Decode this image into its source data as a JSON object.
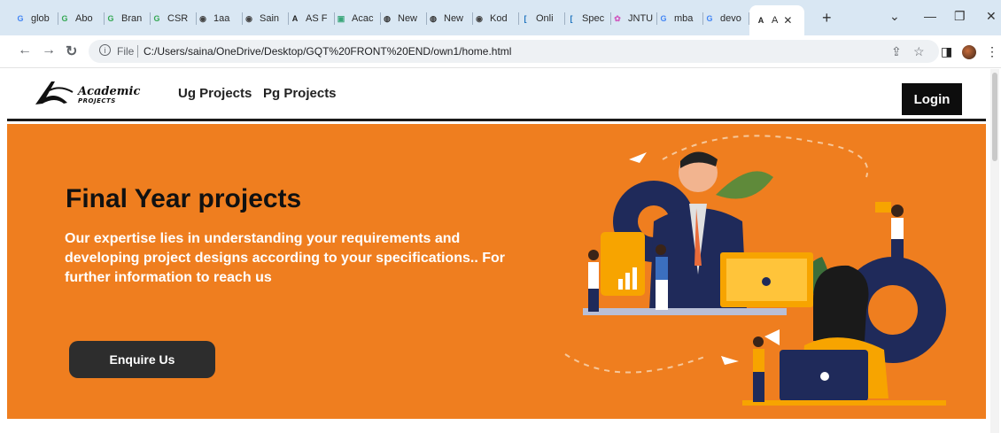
{
  "browser": {
    "tabs": [
      {
        "label": "glob",
        "icon": "google-icon",
        "color": "#4285f4"
      },
      {
        "label": "Abo",
        "icon": "google-icon",
        "color": "#34a853"
      },
      {
        "label": "Bran",
        "icon": "google-icon",
        "color": "#34a853"
      },
      {
        "label": "CSR",
        "icon": "google-icon",
        "color": "#34a853"
      },
      {
        "label": "1aa",
        "icon": "globe-icon",
        "color": "#444444"
      },
      {
        "label": "Sain",
        "icon": "globe-icon",
        "color": "#444444"
      },
      {
        "label": "AS F",
        "icon": "academic-icon",
        "color": "#222222"
      },
      {
        "label": "Acac",
        "icon": "site-icon",
        "color": "#3aa67a"
      },
      {
        "label": "New",
        "icon": "github-icon",
        "color": "#333333"
      },
      {
        "label": "New",
        "icon": "github-icon",
        "color": "#333333"
      },
      {
        "label": "Kod",
        "icon": "globe-icon",
        "color": "#444444"
      },
      {
        "label": "Onli",
        "icon": "bracket-icon",
        "color": "#1e73be"
      },
      {
        "label": "Spec",
        "icon": "bracket-icon",
        "color": "#1e73be"
      },
      {
        "label": "JNTU",
        "icon": "flower-icon",
        "color": "#d05cc0"
      },
      {
        "label": "mba",
        "icon": "google-icon",
        "color": "#4285f4"
      },
      {
        "label": "devo",
        "icon": "google-icon",
        "color": "#4285f4"
      },
      {
        "label": "A",
        "icon": "academic-icon",
        "color": "#222222",
        "active": true
      }
    ],
    "new_tab": "+",
    "url_scheme": "File",
    "url": "C:/Users/saina/OneDrive/Desktop/GQT%20FRONT%20END/own1/home.html"
  },
  "site": {
    "logo_main": "Academic",
    "logo_sub": "PROJECTS",
    "nav": [
      "Ug Projects",
      "Pg Projects"
    ],
    "login": "Login"
  },
  "hero": {
    "title": "Final Year projects",
    "text": "Our expertise lies in understanding your requirements and developing project designs according to your specifications.. For further information to reach us",
    "button": "Enquire Us",
    "bg_color": "#ef7e1f"
  }
}
